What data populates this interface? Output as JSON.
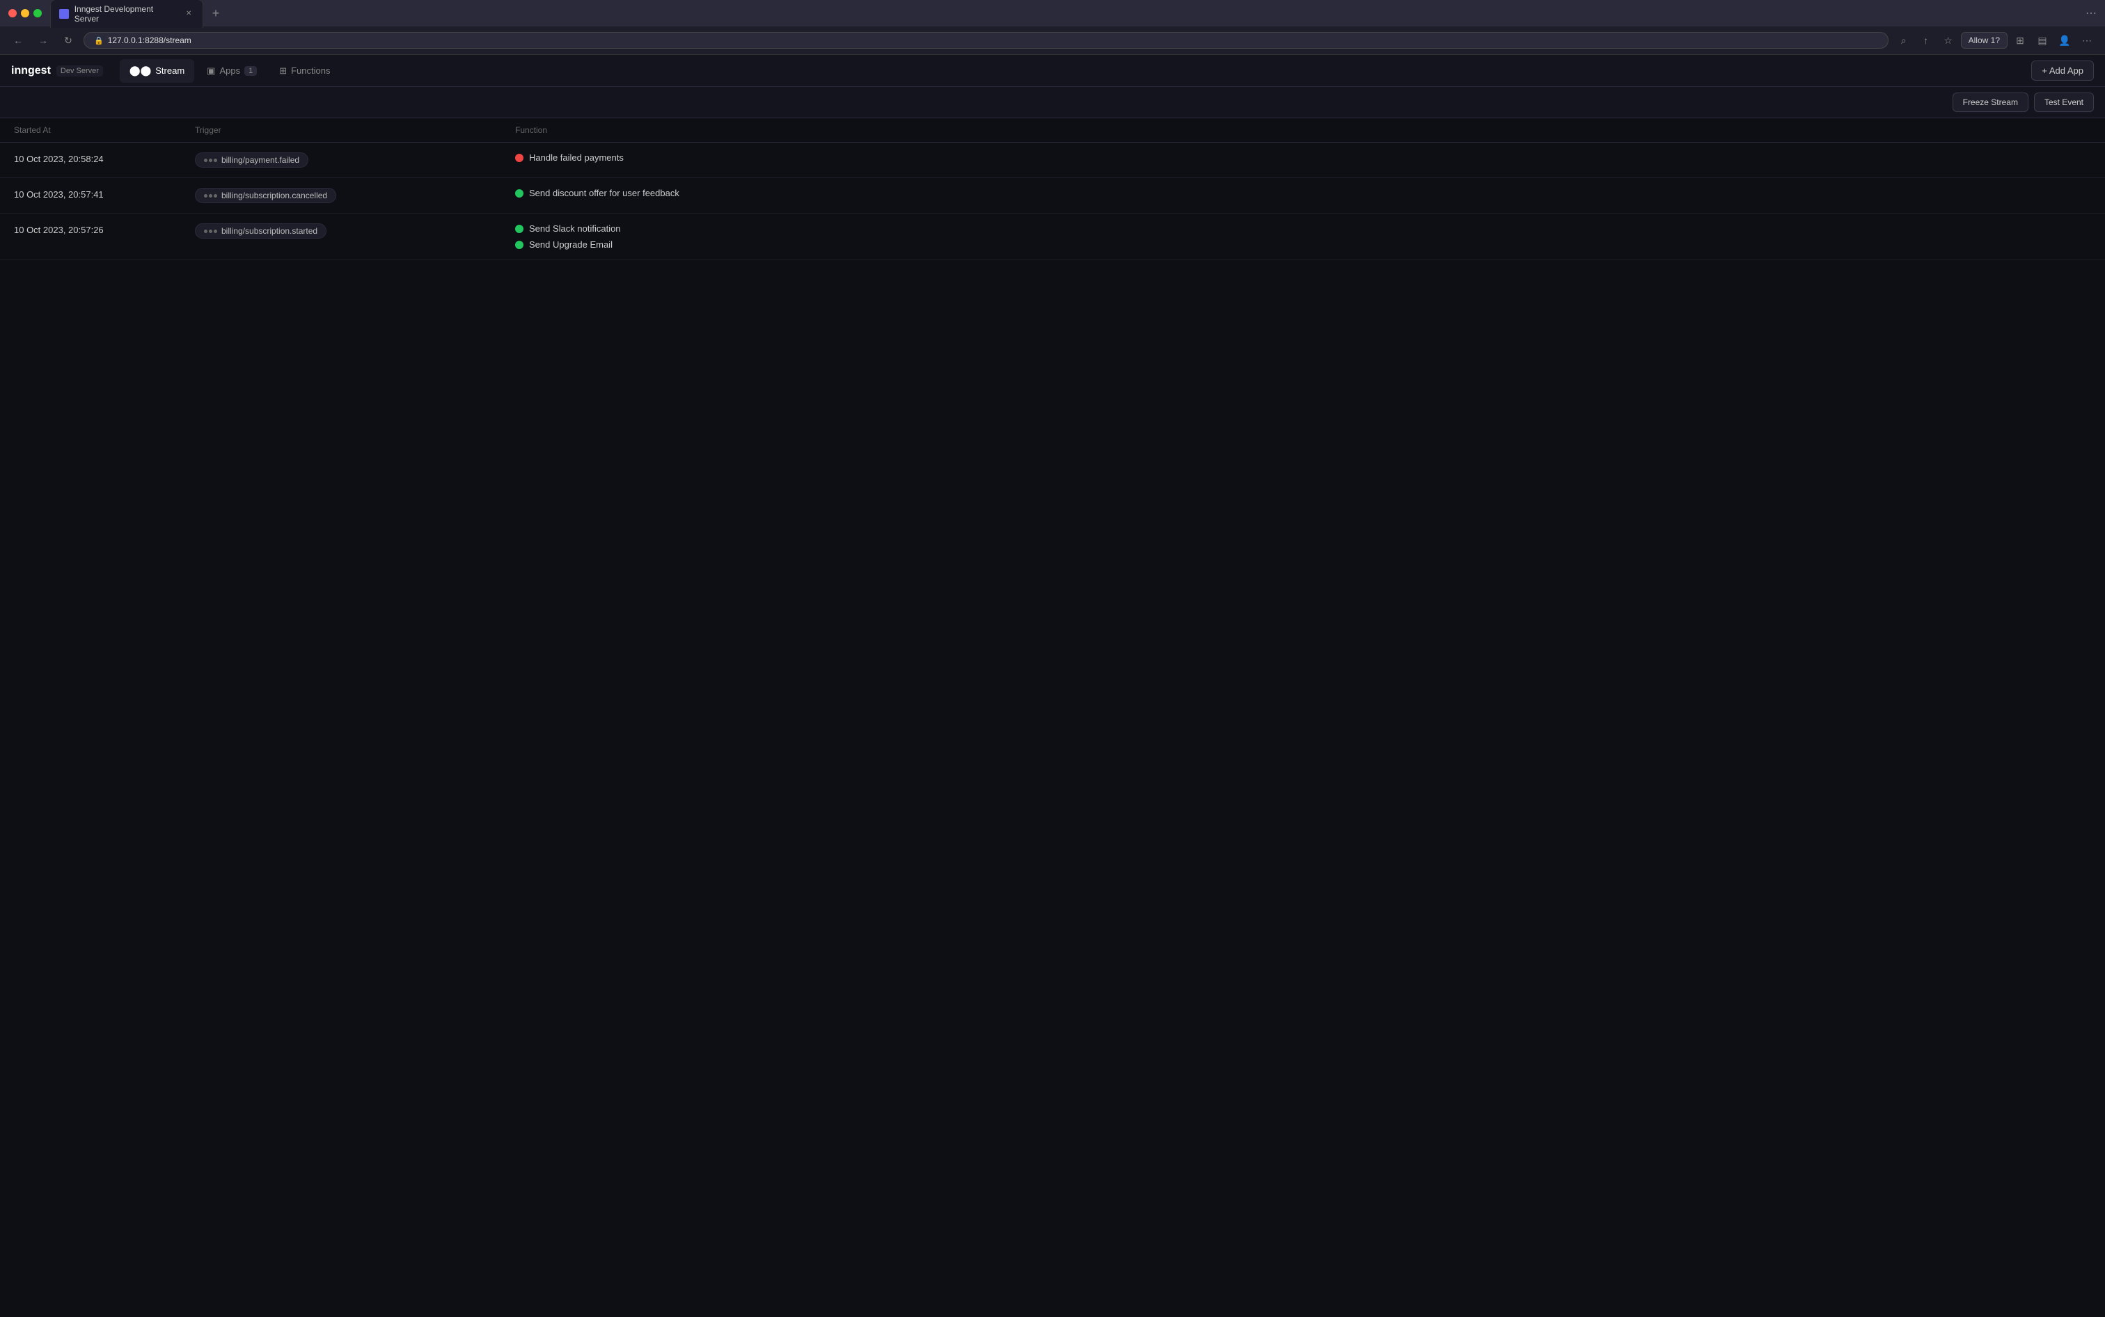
{
  "browser": {
    "tab_title": "Inngest Development Server",
    "url": "127.0.0.1:8288/stream",
    "allow_btn": "Allow 1?",
    "new_tab_label": "+"
  },
  "nav": {
    "logo": "inngest",
    "server_label": "Dev Server",
    "tabs": [
      {
        "id": "stream",
        "label": "Stream",
        "icon": "stream",
        "active": true
      },
      {
        "id": "apps",
        "label": "Apps",
        "badge": "1",
        "icon": "apps",
        "active": false
      },
      {
        "id": "functions",
        "label": "Functions",
        "icon": "functions",
        "active": false
      }
    ],
    "add_app_label": "+ Add App"
  },
  "toolbar": {
    "freeze_stream": "Freeze Stream",
    "test_event": "Test Event"
  },
  "table": {
    "columns": [
      "Started At",
      "Trigger",
      "Function"
    ],
    "rows": [
      {
        "started_at": "10 Oct 2023, 20:58:24",
        "trigger": "billing/payment.failed",
        "functions": [
          {
            "label": "Handle failed payments",
            "status": "error"
          }
        ]
      },
      {
        "started_at": "10 Oct 2023, 20:57:41",
        "trigger": "billing/subscription.cancelled",
        "functions": [
          {
            "label": "Send discount offer for user feedback",
            "status": "success"
          }
        ]
      },
      {
        "started_at": "10 Oct 2023, 20:57:26",
        "trigger": "billing/subscription.started",
        "functions": [
          {
            "label": "Send Slack notification",
            "status": "success"
          },
          {
            "label": "Send Upgrade Email",
            "status": "success"
          }
        ]
      }
    ]
  }
}
